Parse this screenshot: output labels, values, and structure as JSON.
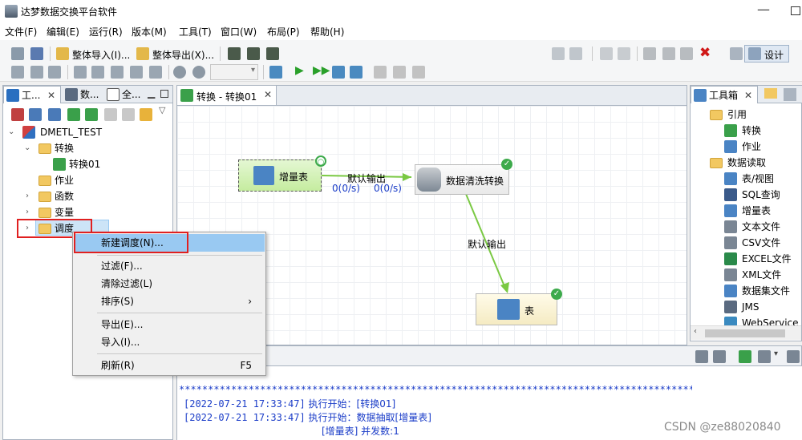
{
  "window": {
    "title": "达梦数据交换平台软件",
    "minimize": "—"
  },
  "menu": [
    "文件(F)",
    "编辑(E)",
    "运行(R)",
    "版本(M)",
    "工具(T)",
    "窗口(W)",
    "布局(P)",
    "帮助(H)"
  ],
  "toolbar": {
    "import_all": "整体导入(I)...",
    "export_all": "整体导出(X)...",
    "design": "设计"
  },
  "left_panel": {
    "tabs": [
      "工...",
      "数...",
      "全..."
    ],
    "tree": {
      "root": "DMETL_TEST",
      "transform_folder": "转换",
      "transform_item": "转换01",
      "job": "作业",
      "function": "函数",
      "variable": "变量",
      "schedule": "调度"
    }
  },
  "editor": {
    "tab": "转换 - 转换01"
  },
  "canvas": {
    "node_incr": "增量表",
    "node_clean": "数据清洗转换",
    "node_table": "表",
    "edge_label_1": "默认输出",
    "edge_label_2": "默认输出",
    "rate_out": "0(0/s)",
    "rate_in": "0(0/s)"
  },
  "context_menu": {
    "new_schedule": "新建调度(N)...",
    "filter": "过滤(F)...",
    "clear_filter": "清除过滤(L)",
    "sort": "排序(S)",
    "export": "导出(E)...",
    "import": "导入(I)...",
    "refresh": "刷新(R)",
    "refresh_shortcut": "F5"
  },
  "toolbox": {
    "tab": "工具箱",
    "items": [
      {
        "label": "引用",
        "kind": "folder"
      },
      {
        "label": "转换",
        "kind": "item"
      },
      {
        "label": "作业",
        "kind": "item"
      },
      {
        "label": "数据读取",
        "kind": "folder"
      },
      {
        "label": "表/视图",
        "kind": "item"
      },
      {
        "label": "SQL查询",
        "kind": "item"
      },
      {
        "label": "增量表",
        "kind": "item"
      },
      {
        "label": "文本文件",
        "kind": "item"
      },
      {
        "label": "CSV文件",
        "kind": "item"
      },
      {
        "label": "EXCEL文件",
        "kind": "item"
      },
      {
        "label": "XML文件",
        "kind": "item"
      },
      {
        "label": "数据集文件",
        "kind": "item"
      },
      {
        "label": "JMS",
        "kind": "item"
      },
      {
        "label": "WebService",
        "kind": "item"
      }
    ]
  },
  "console": {
    "stars": "**********************************************************************************************",
    "lines": [
      {
        "time": "[2022-07-21 17:33:47]",
        "msg": " 执行开始：[转换01]"
      },
      {
        "time": "[2022-07-21 17:33:47]",
        "msg": " 执行开始：数据抽取[增量表]"
      },
      {
        "time": "",
        "msg": "[增量表] 并发数:1"
      }
    ]
  },
  "watermark": "CSDN @ze88020840",
  "colors": {
    "accent": "#3daa4b",
    "highlight_red": "#e02020",
    "selection": "#99c9f2",
    "log_blue": "#1a3cc8"
  }
}
